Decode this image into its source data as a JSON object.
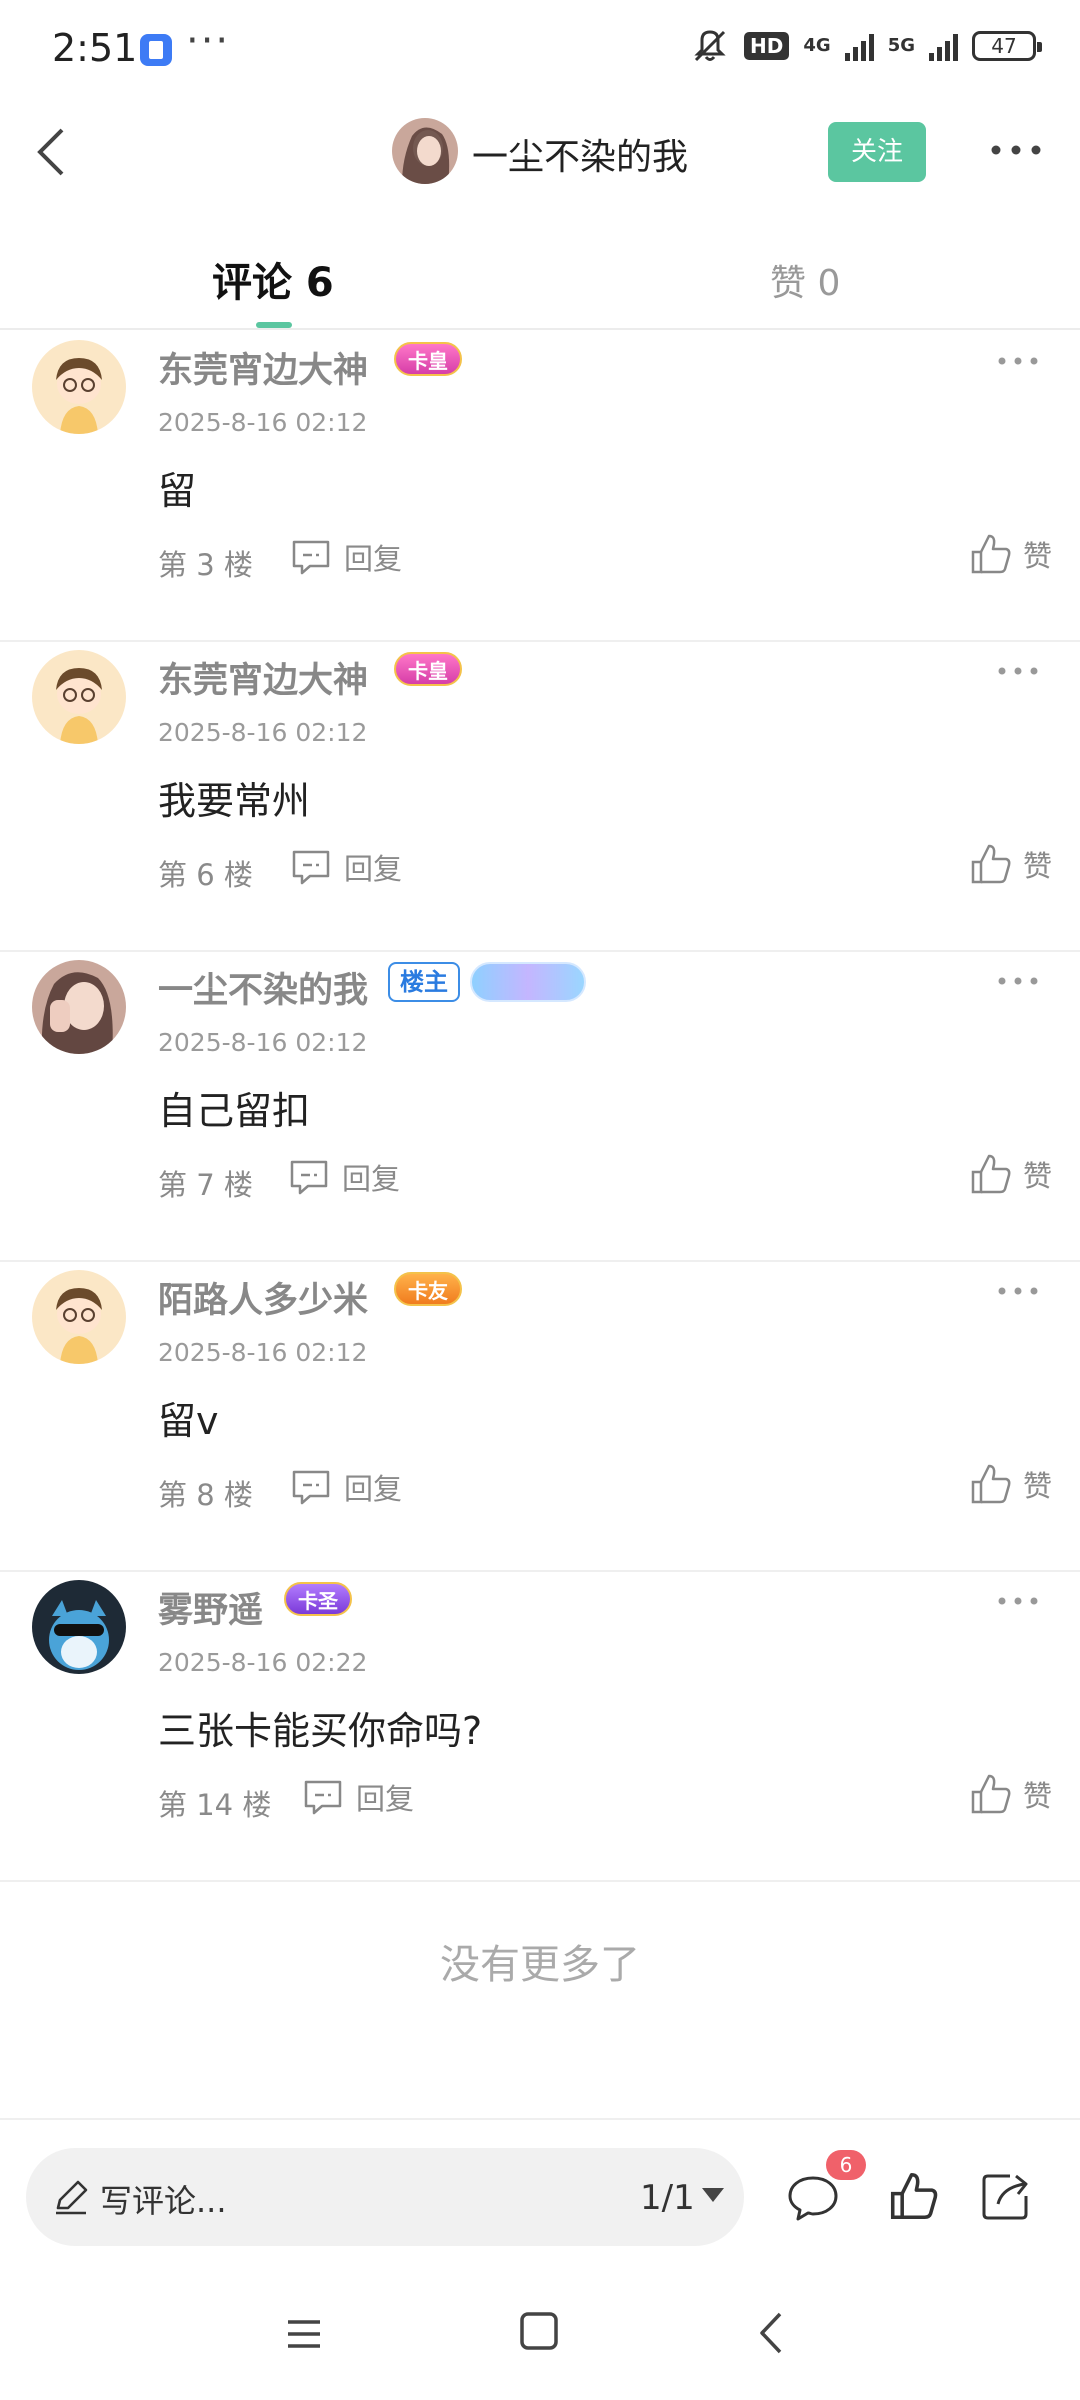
{
  "status_bar": {
    "time": "2:51",
    "hd": "HD",
    "net_4g": "4G",
    "net_5g": "5G",
    "battery": "47"
  },
  "header": {
    "title": "一尘不染的我",
    "follow_label": "关注"
  },
  "tabs": [
    {
      "label": "评论 6",
      "active": true
    },
    {
      "label": "赞 0",
      "active": false
    }
  ],
  "comments": [
    {
      "name": "东莞宵边大神",
      "badges": [
        "卡皇"
      ],
      "time": "2025-8-16 02:12",
      "text": "留",
      "floor": "第 3 楼",
      "reply": "回复",
      "like": "赞"
    },
    {
      "name": "东莞宵边大神",
      "badges": [
        "卡皇"
      ],
      "time": "2025-8-16 02:12",
      "text": "我要常州",
      "floor": "第 6 楼",
      "reply": "回复",
      "like": "赞"
    },
    {
      "name": "一尘不染的我",
      "badges": [
        "楼主"
      ],
      "time": "2025-8-16 02:12",
      "text": "自己留扣",
      "floor": "第 7 楼",
      "reply": "回复",
      "like": "赞"
    },
    {
      "name": "陌路人多少米",
      "badges": [
        "卡友"
      ],
      "time": "2025-8-16 02:12",
      "text": "留v",
      "floor": "第 8 楼",
      "reply": "回复",
      "like": "赞"
    },
    {
      "name": "雾野遥",
      "badges": [
        "卡圣"
      ],
      "time": "2025-8-16 02:22",
      "text": "三张卡能买你命吗?",
      "floor": "第 14 楼",
      "reply": "回复",
      "like": "赞"
    }
  ],
  "end_note": "没有更多了",
  "bottom_bar": {
    "placeholder": "写评论...",
    "page": "1/1",
    "comment_count": "6"
  },
  "colors": {
    "accent": "#5bc6a0",
    "badge_red": "#f0616a",
    "host_blue": "#2a7be0"
  }
}
